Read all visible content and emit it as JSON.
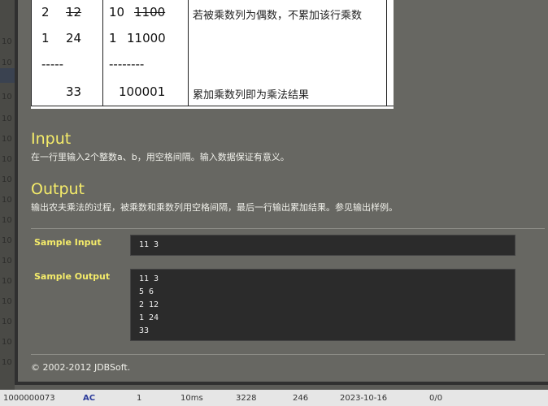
{
  "background": {
    "row_id_prefix": "10",
    "bottom_row": {
      "run_id": "1000000073",
      "result": "AC",
      "problem": "1",
      "time": "10ms",
      "memory": "3228",
      "length": "246",
      "date": "2023-10-16",
      "score": "0/0"
    }
  },
  "example_table": {
    "rows": [
      {
        "left_a": "2",
        "left_b": "12",
        "mid_a": "10",
        "mid_b": "1100",
        "note": "若被乘数列为偶数，不累加该行乘数"
      },
      {
        "left_a": "1",
        "left_b": "24",
        "mid_a": "1",
        "mid_b": "11000",
        "note": ""
      }
    ],
    "separator_left": "-----",
    "separator_mid": "--------",
    "total_left": "33",
    "total_mid": "100001",
    "total_note": "累加乘数列即为乘法结果"
  },
  "input_section": {
    "title": "Input",
    "text": "在一行里输入2个整数a、b，用空格间隔。输入数据保证有意义。"
  },
  "output_section": {
    "title": "Output",
    "text": "输出农夫乘法的过程，被乘数和乘数列用空格间隔，最后一行输出累加结果。参见输出样例。"
  },
  "sample_input": {
    "label": "Sample Input",
    "content": "11 3"
  },
  "sample_output": {
    "label": "Sample Output",
    "content": "11 3\n5 6\n2 12\n1 24\n33"
  },
  "footer": {
    "text": "© 2002-2012  JDBSoft."
  },
  "colors": {
    "heading": "#f5ec6a",
    "modal_bg": "#676762",
    "code_bg": "#2b2b2b"
  }
}
